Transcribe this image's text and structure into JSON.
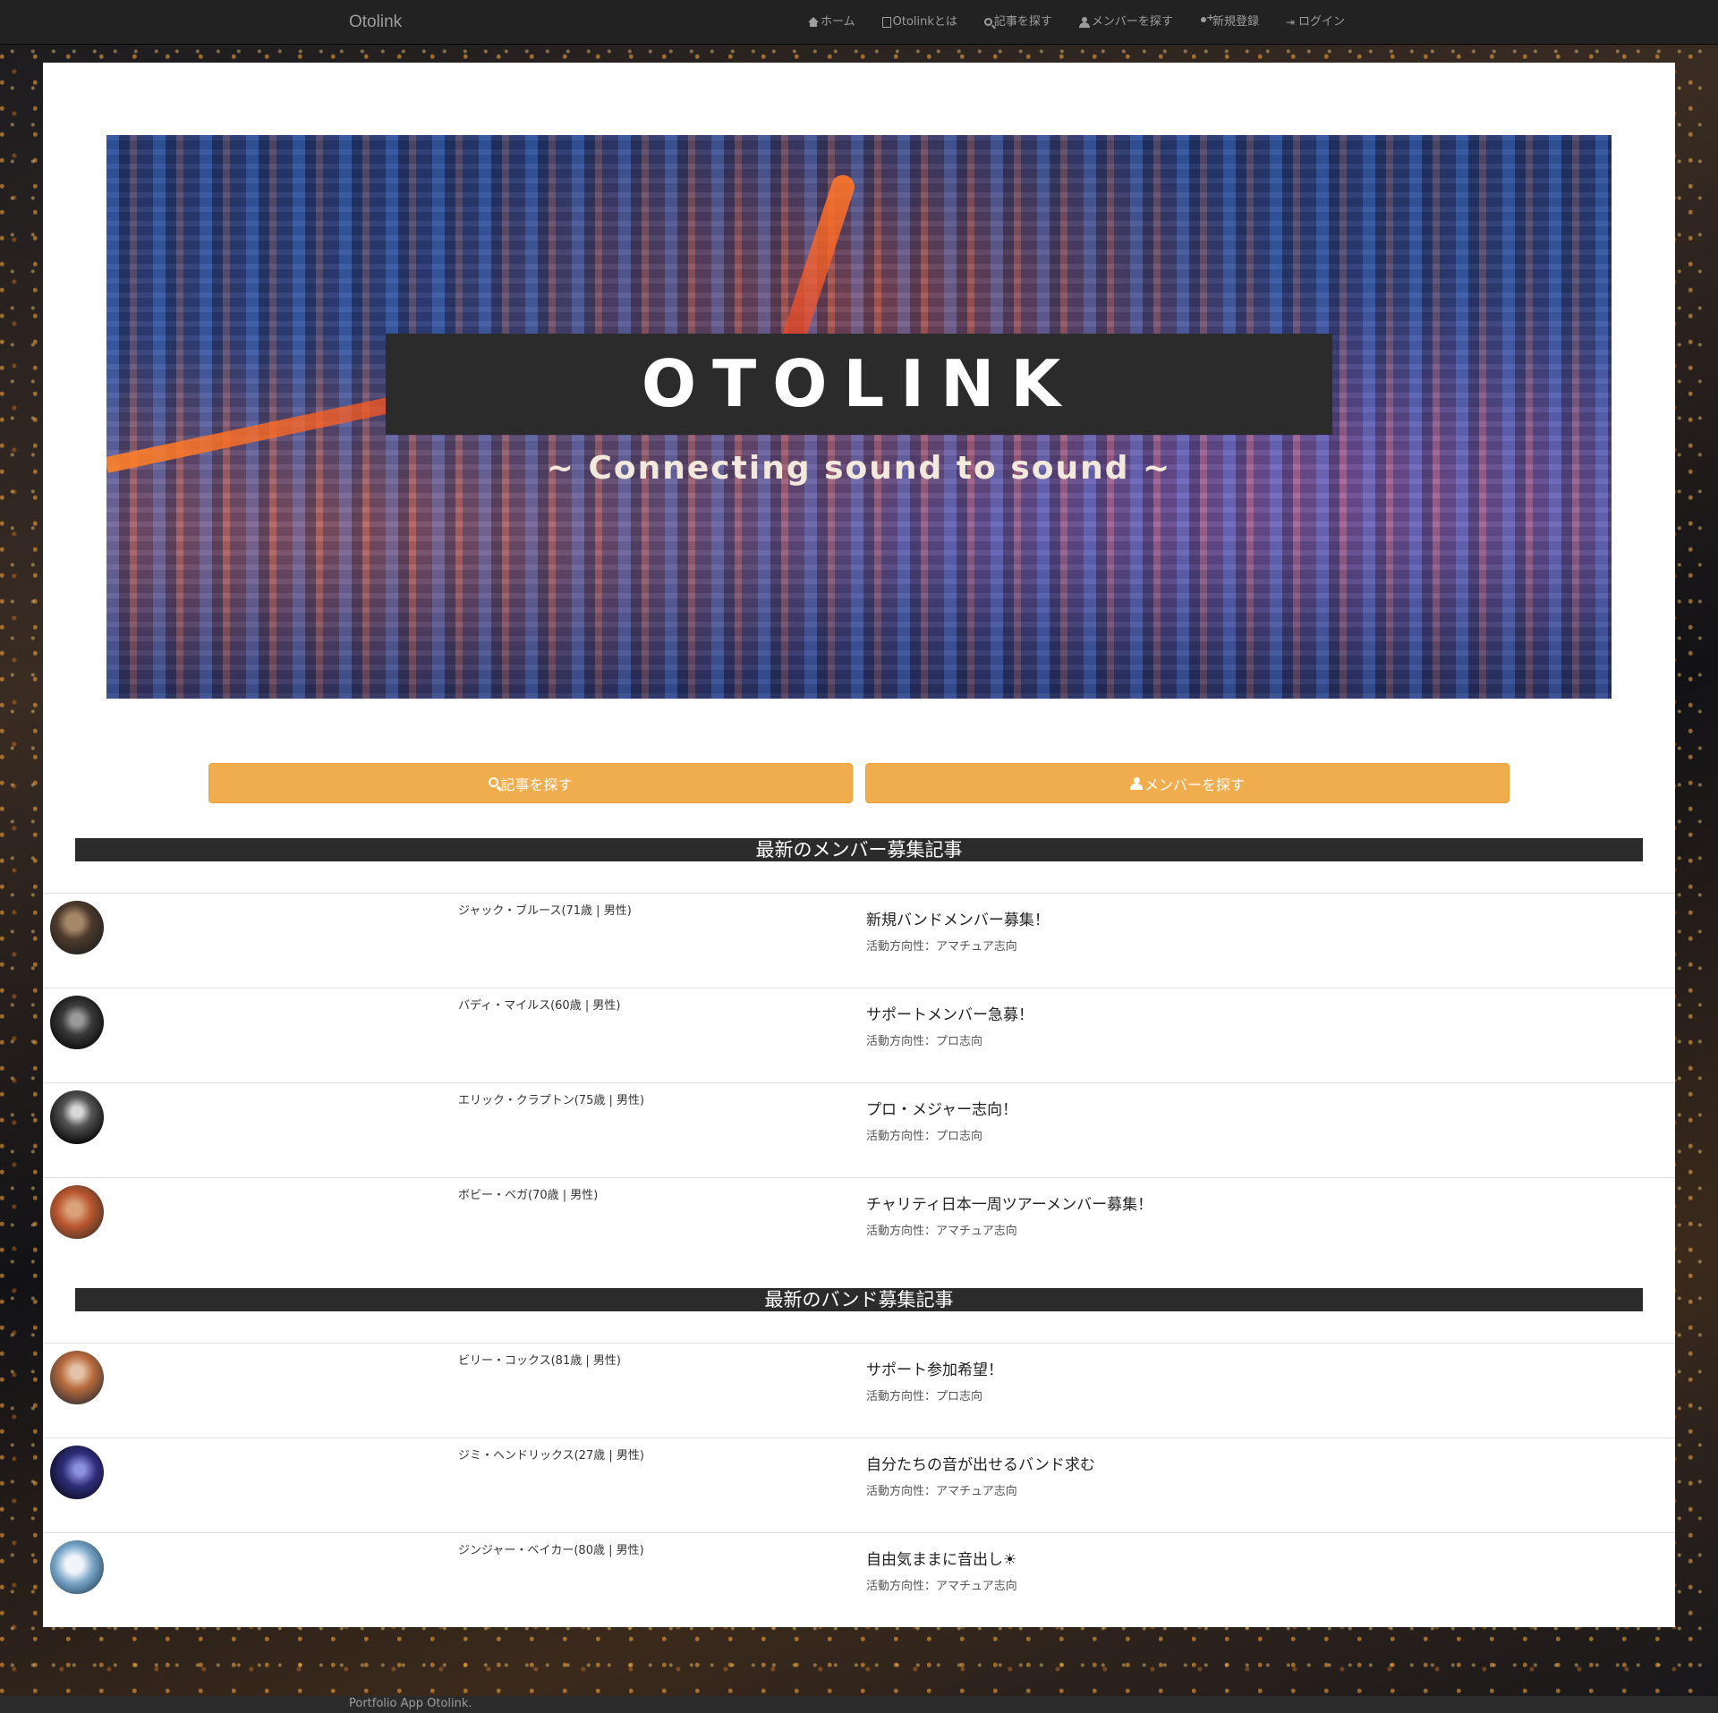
{
  "navbar": {
    "brand": "Otolink",
    "items": [
      {
        "label": "ホーム",
        "icon": "home-icon"
      },
      {
        "label": "Otolinkとは",
        "icon": "file-icon"
      },
      {
        "label": "記事を探す",
        "icon": "search-icon"
      },
      {
        "label": "メンバーを探す",
        "icon": "users-icon"
      },
      {
        "label": "新規登録",
        "icon": "add-user-icon"
      },
      {
        "label": "ログイン",
        "icon": "login-icon"
      }
    ]
  },
  "hero": {
    "title": "OTOLINK",
    "subtitle": "~ Connecting sound to sound ~"
  },
  "buttons": {
    "search_articles": "記事を探す",
    "search_members": "メンバーを探す"
  },
  "member_section": {
    "heading": "最新のメンバー募集記事",
    "posts": [
      {
        "author": "ジャック・ブルース(71歳 | 男性)",
        "title": "新規バンドメンバー募集！",
        "direction": "活動方向性：アマチュア志向"
      },
      {
        "author": "バディ・マイルス(60歳 | 男性)",
        "title": "サポートメンバー急募！",
        "direction": "活動方向性：プロ志向"
      },
      {
        "author": "エリック・クラプトン(75歳 | 男性)",
        "title": "プロ・メジャー志向！",
        "direction": "活動方向性：プロ志向"
      },
      {
        "author": "ボビー・ベガ(70歳 | 男性)",
        "title": "チャリティ日本一周ツアーメンバー募集！",
        "direction": "活動方向性：アマチュア志向"
      }
    ]
  },
  "band_section": {
    "heading": "最新のバンド募集記事",
    "posts": [
      {
        "author": "ビリー・コックス(81歳 | 男性)",
        "title": "サポート参加希望！",
        "direction": "活動方向性：プロ志向"
      },
      {
        "author": "ジミ・ヘンドリックス(27歳 | 男性)",
        "title": "自分たちの音が出せるバンド求む",
        "direction": "活動方向性：アマチュア志向"
      },
      {
        "author": "ジンジャー・ベイカー(80歳 | 男性)",
        "title": "自由気ままに音出し☀",
        "direction": "活動方向性：アマチュア志向"
      }
    ]
  },
  "footer": {
    "text": "Portfolio App Otolink."
  },
  "colors": {
    "accent_button": "#f0ad4e",
    "navbar_bg": "#222222",
    "section_header_bg": "#2b2b2b"
  }
}
